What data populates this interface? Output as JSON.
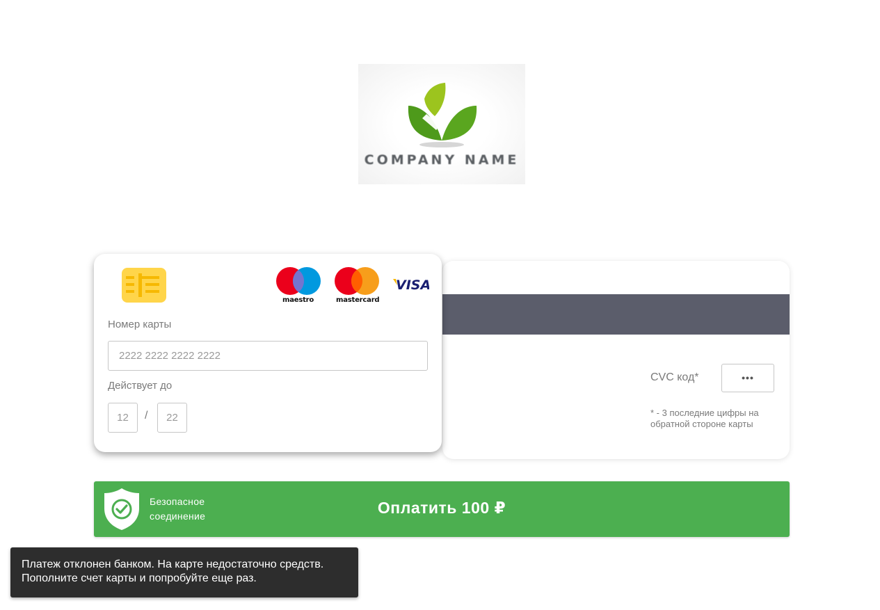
{
  "logo": {
    "text": "COMPANY NAME",
    "icon": "leaf-checkmark-logo"
  },
  "card_front": {
    "chip_icon": "chip-icon",
    "brands": [
      {
        "name": "maestro",
        "icon": "maestro-logo"
      },
      {
        "name": "mastercard",
        "icon": "mastercard-logo"
      },
      {
        "name": "VISA",
        "icon": "visa-logo"
      }
    ],
    "number_label": "Номер карты",
    "number_placeholder": "2222 2222 2222 2222",
    "expiry_label": "Действует до",
    "month_placeholder": "12",
    "year_placeholder": "22",
    "separator": "/"
  },
  "card_back": {
    "cvc_label": "CVC код*",
    "cvc_placeholder": "•••",
    "cvc_hint": "* - 3 последние цифры на обратной стороне карты"
  },
  "pay_bar": {
    "secure_line1": "Безопасное",
    "secure_line2": "соединение",
    "pay_label": "Оплатить 100 ₽",
    "shield_icon": "shield-check-icon"
  },
  "toast": {
    "line1": "Платеж отклонен банком. На карте недостаточно средств.",
    "line2": "Пополните счет карты и попробуйте еще раз."
  },
  "colors": {
    "accent_green": "#4caf50",
    "stripe": "#5b5d6b",
    "chip": "#ffd54a",
    "toast_bg": "#2d2d2d"
  }
}
